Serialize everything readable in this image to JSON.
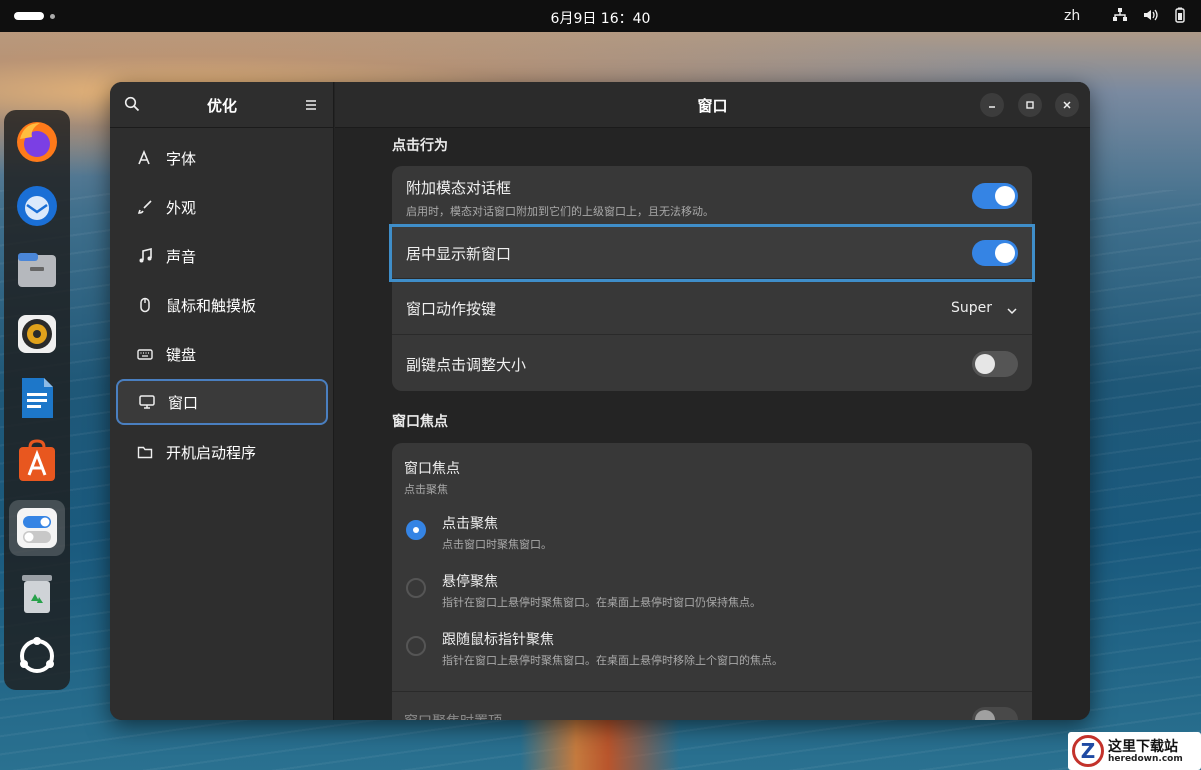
{
  "topbar": {
    "clock": "6月9日  16：40",
    "lang": "zh"
  },
  "dock": {
    "items": [
      {
        "name": "firefox-icon"
      },
      {
        "name": "thunderbird-icon"
      },
      {
        "name": "files-icon"
      },
      {
        "name": "rhythmbox-icon"
      },
      {
        "name": "writer-icon"
      },
      {
        "name": "app-center-icon"
      },
      {
        "name": "tweaks-icon",
        "active": true
      },
      {
        "name": "trash-icon"
      },
      {
        "name": "show-apps-icon"
      }
    ]
  },
  "sidebar": {
    "title": "优化",
    "items": [
      {
        "label": "字体",
        "icon": "font-icon"
      },
      {
        "label": "外观",
        "icon": "brush-icon"
      },
      {
        "label": "声音",
        "icon": "music-note-icon"
      },
      {
        "label": "鼠标和触摸板",
        "icon": "mouse-icon"
      },
      {
        "label": "键盘",
        "icon": "keyboard-icon"
      },
      {
        "label": "窗口",
        "icon": "monitor-icon",
        "selected": true
      },
      {
        "label": "开机启动程序",
        "icon": "folder-icon"
      }
    ]
  },
  "main": {
    "title": "窗口",
    "click_section": {
      "title": "点击行为",
      "rows": [
        {
          "label": "附加模态对话框",
          "sub": "启用时，模态对话窗口附加到它们的上级窗口上，且无法移动。",
          "toggle": true
        },
        {
          "label": "居中显示新窗口",
          "toggle": true
        },
        {
          "label": "窗口动作按键",
          "value": "Super"
        },
        {
          "label": "副键点击调整大小",
          "toggle": false
        }
      ]
    },
    "focus_section": {
      "title": "窗口焦点",
      "group_label": "窗口焦点",
      "group_sub": "点击聚焦",
      "options": [
        {
          "label": "点击聚焦",
          "sub": "点击窗口时聚焦窗口。",
          "checked": true
        },
        {
          "label": "悬停聚焦",
          "sub": "指针在窗口上悬停时聚焦窗口。在桌面上悬停时窗口仍保持焦点。",
          "checked": false
        },
        {
          "label": "跟随鼠标指针聚焦",
          "sub": "指针在窗口上悬停时聚焦窗口。在桌面上悬停时移除上个窗口的焦点。",
          "checked": false
        }
      ],
      "cut_row_label": "窗口聚焦时置顶"
    }
  },
  "watermark": {
    "text": "这里下载站",
    "url": "heredown.com"
  },
  "colors": {
    "accent": "#3584e4",
    "window_bg": "#242424",
    "card_bg": "#383838"
  }
}
